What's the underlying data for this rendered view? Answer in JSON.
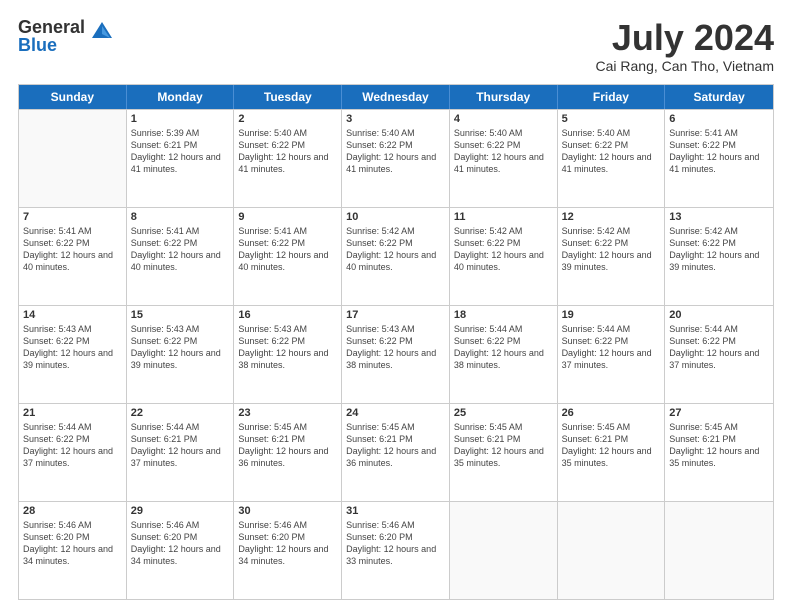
{
  "logo": {
    "general": "General",
    "blue": "Blue"
  },
  "title": {
    "month_year": "July 2024",
    "location": "Cai Rang, Can Tho, Vietnam"
  },
  "header_days": [
    "Sunday",
    "Monday",
    "Tuesday",
    "Wednesday",
    "Thursday",
    "Friday",
    "Saturday"
  ],
  "weeks": [
    [
      {
        "day": "",
        "sunrise": "",
        "sunset": "",
        "daylight": "",
        "empty": true
      },
      {
        "day": "1",
        "sunrise": "Sunrise: 5:39 AM",
        "sunset": "Sunset: 6:21 PM",
        "daylight": "Daylight: 12 hours and 41 minutes."
      },
      {
        "day": "2",
        "sunrise": "Sunrise: 5:40 AM",
        "sunset": "Sunset: 6:22 PM",
        "daylight": "Daylight: 12 hours and 41 minutes."
      },
      {
        "day": "3",
        "sunrise": "Sunrise: 5:40 AM",
        "sunset": "Sunset: 6:22 PM",
        "daylight": "Daylight: 12 hours and 41 minutes."
      },
      {
        "day": "4",
        "sunrise": "Sunrise: 5:40 AM",
        "sunset": "Sunset: 6:22 PM",
        "daylight": "Daylight: 12 hours and 41 minutes."
      },
      {
        "day": "5",
        "sunrise": "Sunrise: 5:40 AM",
        "sunset": "Sunset: 6:22 PM",
        "daylight": "Daylight: 12 hours and 41 minutes."
      },
      {
        "day": "6",
        "sunrise": "Sunrise: 5:41 AM",
        "sunset": "Sunset: 6:22 PM",
        "daylight": "Daylight: 12 hours and 41 minutes."
      }
    ],
    [
      {
        "day": "7",
        "sunrise": "Sunrise: 5:41 AM",
        "sunset": "Sunset: 6:22 PM",
        "daylight": "Daylight: 12 hours and 40 minutes."
      },
      {
        "day": "8",
        "sunrise": "Sunrise: 5:41 AM",
        "sunset": "Sunset: 6:22 PM",
        "daylight": "Daylight: 12 hours and 40 minutes."
      },
      {
        "day": "9",
        "sunrise": "Sunrise: 5:41 AM",
        "sunset": "Sunset: 6:22 PM",
        "daylight": "Daylight: 12 hours and 40 minutes."
      },
      {
        "day": "10",
        "sunrise": "Sunrise: 5:42 AM",
        "sunset": "Sunset: 6:22 PM",
        "daylight": "Daylight: 12 hours and 40 minutes."
      },
      {
        "day": "11",
        "sunrise": "Sunrise: 5:42 AM",
        "sunset": "Sunset: 6:22 PM",
        "daylight": "Daylight: 12 hours and 40 minutes."
      },
      {
        "day": "12",
        "sunrise": "Sunrise: 5:42 AM",
        "sunset": "Sunset: 6:22 PM",
        "daylight": "Daylight: 12 hours and 39 minutes."
      },
      {
        "day": "13",
        "sunrise": "Sunrise: 5:42 AM",
        "sunset": "Sunset: 6:22 PM",
        "daylight": "Daylight: 12 hours and 39 minutes."
      }
    ],
    [
      {
        "day": "14",
        "sunrise": "Sunrise: 5:43 AM",
        "sunset": "Sunset: 6:22 PM",
        "daylight": "Daylight: 12 hours and 39 minutes."
      },
      {
        "day": "15",
        "sunrise": "Sunrise: 5:43 AM",
        "sunset": "Sunset: 6:22 PM",
        "daylight": "Daylight: 12 hours and 39 minutes."
      },
      {
        "day": "16",
        "sunrise": "Sunrise: 5:43 AM",
        "sunset": "Sunset: 6:22 PM",
        "daylight": "Daylight: 12 hours and 38 minutes."
      },
      {
        "day": "17",
        "sunrise": "Sunrise: 5:43 AM",
        "sunset": "Sunset: 6:22 PM",
        "daylight": "Daylight: 12 hours and 38 minutes."
      },
      {
        "day": "18",
        "sunrise": "Sunrise: 5:44 AM",
        "sunset": "Sunset: 6:22 PM",
        "daylight": "Daylight: 12 hours and 38 minutes."
      },
      {
        "day": "19",
        "sunrise": "Sunrise: 5:44 AM",
        "sunset": "Sunset: 6:22 PM",
        "daylight": "Daylight: 12 hours and 37 minutes."
      },
      {
        "day": "20",
        "sunrise": "Sunrise: 5:44 AM",
        "sunset": "Sunset: 6:22 PM",
        "daylight": "Daylight: 12 hours and 37 minutes."
      }
    ],
    [
      {
        "day": "21",
        "sunrise": "Sunrise: 5:44 AM",
        "sunset": "Sunset: 6:22 PM",
        "daylight": "Daylight: 12 hours and 37 minutes."
      },
      {
        "day": "22",
        "sunrise": "Sunrise: 5:44 AM",
        "sunset": "Sunset: 6:21 PM",
        "daylight": "Daylight: 12 hours and 37 minutes."
      },
      {
        "day": "23",
        "sunrise": "Sunrise: 5:45 AM",
        "sunset": "Sunset: 6:21 PM",
        "daylight": "Daylight: 12 hours and 36 minutes."
      },
      {
        "day": "24",
        "sunrise": "Sunrise: 5:45 AM",
        "sunset": "Sunset: 6:21 PM",
        "daylight": "Daylight: 12 hours and 36 minutes."
      },
      {
        "day": "25",
        "sunrise": "Sunrise: 5:45 AM",
        "sunset": "Sunset: 6:21 PM",
        "daylight": "Daylight: 12 hours and 35 minutes."
      },
      {
        "day": "26",
        "sunrise": "Sunrise: 5:45 AM",
        "sunset": "Sunset: 6:21 PM",
        "daylight": "Daylight: 12 hours and 35 minutes."
      },
      {
        "day": "27",
        "sunrise": "Sunrise: 5:45 AM",
        "sunset": "Sunset: 6:21 PM",
        "daylight": "Daylight: 12 hours and 35 minutes."
      }
    ],
    [
      {
        "day": "28",
        "sunrise": "Sunrise: 5:46 AM",
        "sunset": "Sunset: 6:20 PM",
        "daylight": "Daylight: 12 hours and 34 minutes."
      },
      {
        "day": "29",
        "sunrise": "Sunrise: 5:46 AM",
        "sunset": "Sunset: 6:20 PM",
        "daylight": "Daylight: 12 hours and 34 minutes."
      },
      {
        "day": "30",
        "sunrise": "Sunrise: 5:46 AM",
        "sunset": "Sunset: 6:20 PM",
        "daylight": "Daylight: 12 hours and 34 minutes."
      },
      {
        "day": "31",
        "sunrise": "Sunrise: 5:46 AM",
        "sunset": "Sunset: 6:20 PM",
        "daylight": "Daylight: 12 hours and 33 minutes."
      },
      {
        "day": "",
        "sunrise": "",
        "sunset": "",
        "daylight": "",
        "empty": true
      },
      {
        "day": "",
        "sunrise": "",
        "sunset": "",
        "daylight": "",
        "empty": true
      },
      {
        "day": "",
        "sunrise": "",
        "sunset": "",
        "daylight": "",
        "empty": true
      }
    ]
  ]
}
